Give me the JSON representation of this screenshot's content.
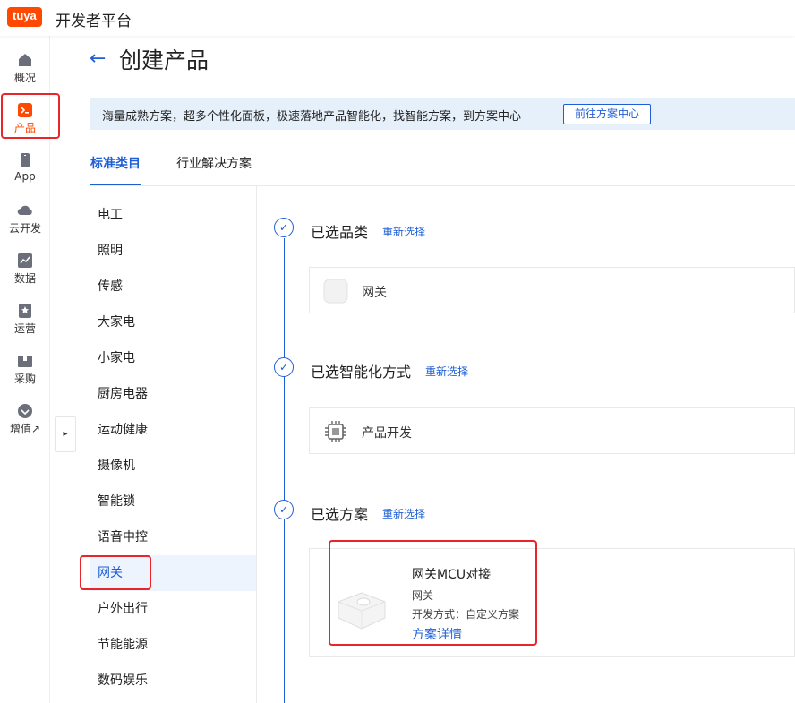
{
  "brand": {
    "logo_text": "tuya",
    "name": "开发者平台"
  },
  "nav": {
    "items": [
      {
        "label": "概况",
        "icon": "home-icon"
      },
      {
        "label": "产品",
        "icon": "product-icon",
        "active": true
      },
      {
        "label": "App",
        "icon": "phone-icon"
      },
      {
        "label": "云开发",
        "icon": "cloud-icon"
      },
      {
        "label": "数据",
        "icon": "chart-icon"
      },
      {
        "label": "运营",
        "icon": "bookmark-icon"
      },
      {
        "label": "采购",
        "icon": "box-icon"
      },
      {
        "label": "增值↗",
        "icon": "heart-icon"
      }
    ],
    "collapse_icon": "▸"
  },
  "page": {
    "back_icon": "←",
    "title": "创建产品"
  },
  "banner": {
    "text": "海量成熟方案，超多个性化面板，极速落地产品智能化，找智能方案，到方案中心",
    "button": "前往方案中心"
  },
  "tabs": [
    {
      "label": "标准类目",
      "active": true
    },
    {
      "label": "行业解决方案",
      "active": false
    }
  ],
  "categories": [
    "电工",
    "照明",
    "传感",
    "大家电",
    "小家电",
    "厨房电器",
    "运动健康",
    "摄像机",
    "智能锁",
    "语音中控",
    "网关",
    "户外出行",
    "节能能源",
    "数码娱乐"
  ],
  "selected_category_index": 10,
  "steps": [
    {
      "title": "已选品类",
      "link": "重新选择",
      "card_label": "网关"
    },
    {
      "title": "已选智能化方式",
      "link": "重新选择",
      "card_label": "产品开发"
    },
    {
      "title": "已选方案",
      "link": "重新选择"
    }
  ],
  "solution": {
    "name": "网关MCU对接",
    "category": "网关",
    "dev_method": "开发方式：自定义方案",
    "detail_link": "方案详情"
  },
  "colors": {
    "brand": "#ff4800",
    "accent": "#1f5fd6",
    "highlight": "#e8262a"
  }
}
